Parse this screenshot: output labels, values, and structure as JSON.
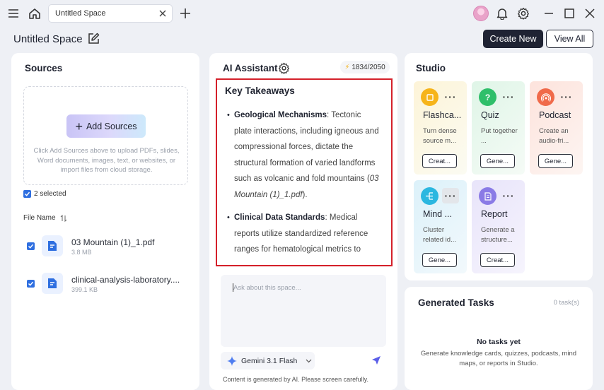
{
  "titlebar": {
    "tab_title": "Untitled Space"
  },
  "header": {
    "space_title": "Untitled Space",
    "create_new_label": "Create New",
    "view_all_label": "View All"
  },
  "sources": {
    "title": "Sources",
    "add_sources_label": "Add Sources",
    "dropzone_hint": "Click Add Sources above to upload PDFs, slides, Word documents, images, text, or websites, or import files from cloud storage.",
    "selected_count": "2 selected",
    "file_name_header": "File Name",
    "files": [
      {
        "name": "03 Mountain (1)_1.pdf",
        "size": "3.8 MB"
      },
      {
        "name": "clinical-analysis-laboratory....",
        "size": "399.1 KB"
      }
    ]
  },
  "assistant": {
    "title": "AI Assistant",
    "credits": "1834/2050",
    "takeaways_title": "Key Takeaways",
    "takeaways": [
      {
        "term": "Geological Mechanisms",
        "text": ": Tectonic plate interactions, including igneous and compressional forces, dictate the structural formation of varied landforms such as volcanic and fold mountains (",
        "cite": "03 Mountain (1)_1.pdf",
        "tail": ")."
      },
      {
        "term": "Clinical Data Standards",
        "text": ": Medical reports utilize standardized reference ranges for hematological metrics to",
        "cite": "",
        "tail": ""
      }
    ],
    "ask_placeholder": "Ask about this space...",
    "model_name": "Gemini 3.1 Flash",
    "disclaimer": "Content is generated by AI. Please screen carefully."
  },
  "studio": {
    "title": "Studio",
    "cards": [
      {
        "title": "Flashca...",
        "desc": "Turn dense source m...",
        "button": "Creat..."
      },
      {
        "title": "Quiz",
        "desc": "Put together ...",
        "button": "Gene..."
      },
      {
        "title": "Podcast",
        "desc": "Create an audio-fri...",
        "button": "Gene..."
      },
      {
        "title": "Mind ...",
        "desc": "Cluster related id...",
        "button": "Gene..."
      },
      {
        "title": "Report",
        "desc": "Generate a structure...",
        "button": "Creat..."
      }
    ]
  },
  "tasks": {
    "title": "Generated Tasks",
    "count": "0 task(s)",
    "empty_title": "No tasks yet",
    "empty_desc": "Generate knowledge cards, quizzes, podcasts, mind maps, or reports in Studio."
  },
  "colors": {
    "primary_dark": "#1f2333",
    "highlight_border": "#d4202a",
    "checkbox_blue": "#2f6fe0",
    "flashcard_accent": "#f6b41a",
    "quiz_accent": "#2fbf6a",
    "podcast_accent": "#f06a4a",
    "mindmap_accent": "#2bb7e0",
    "report_accent": "#8a7be6"
  }
}
